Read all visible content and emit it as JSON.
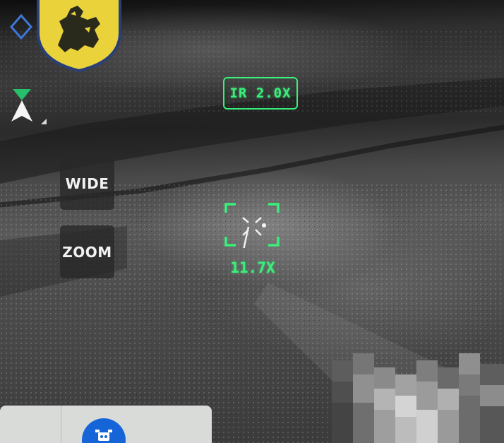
{
  "camera": {
    "mode_badge": "IR 2.0X",
    "reticle_zoom": "11.7X"
  },
  "controls": {
    "wide_label": "WIDE",
    "zoom_label": "ZOOM"
  },
  "icons": {
    "emblem": "lion-shield-icon",
    "compass": "diamond-compass-icon",
    "nav": "north-arrow-icon",
    "drone": "drone-icon"
  },
  "colors": {
    "hud_green": "#39f07a",
    "emblem_yellow": "#e9d23a",
    "emblem_border": "#2a3f7a",
    "accent_blue": "#1565d8"
  }
}
